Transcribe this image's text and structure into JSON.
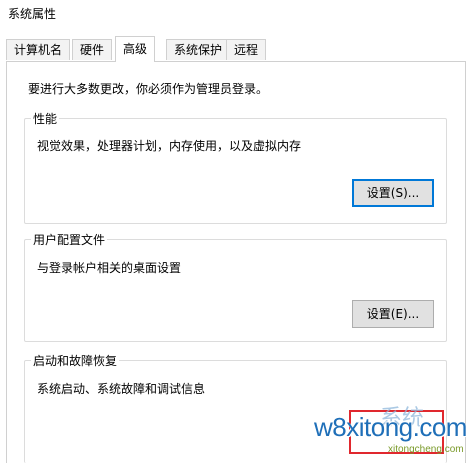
{
  "window": {
    "title": "系统属性"
  },
  "tabs": [
    {
      "label": "计算机名"
    },
    {
      "label": "硬件"
    },
    {
      "label": "高级"
    },
    {
      "label": "系统保护"
    },
    {
      "label": "远程"
    }
  ],
  "admin_note": "要进行大多数更改，你必须作为管理员登录。",
  "performance": {
    "title": "性能",
    "description": "视觉效果，处理器计划，内存使用，以及虚拟内存",
    "button": "设置(S)..."
  },
  "user_profiles": {
    "title": "用户配置文件",
    "description": "与登录帐户相关的桌面设置",
    "button": "设置(E)..."
  },
  "startup_recovery": {
    "title": "启动和故障恢复",
    "description": "系统启动、系统故障和调试信息"
  },
  "watermark": {
    "text": "w8xitong.com",
    "subtext": "xitongcheng.com",
    "cn": "系统"
  },
  "colors": {
    "focus_border": "#0078d7",
    "highlight_box": "#e0282e",
    "watermark_blue": "#1f6fb8"
  }
}
